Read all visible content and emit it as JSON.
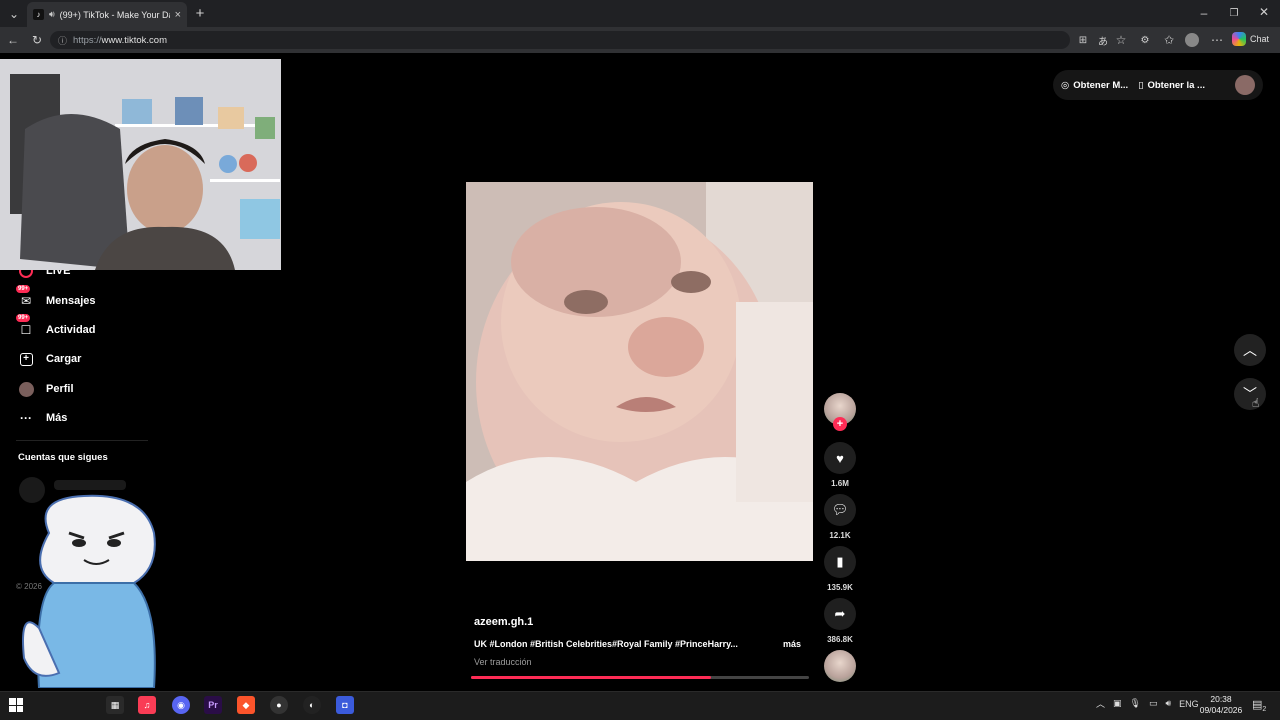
{
  "browser": {
    "tab_title": "(99+) TikTok - Make Your Day",
    "new_tab": "+",
    "url_protocol": "https://",
    "url_host": "www.tiktok.com",
    "chat_label": "Chat",
    "window_controls": [
      "minimize-icon",
      "restore-icon",
      "close-icon"
    ]
  },
  "sidebar": {
    "items": [
      {
        "label": "LIVE",
        "icon": "live-icon"
      },
      {
        "label": "Mensajes",
        "icon": "message-icon",
        "badge": "99+"
      },
      {
        "label": "Actividad",
        "icon": "activity-icon",
        "badge": "99+"
      },
      {
        "label": "Cargar",
        "icon": "upload-icon"
      },
      {
        "label": "Perfil",
        "icon": "profile-icon"
      },
      {
        "label": "Más",
        "icon": "more-icon"
      }
    ],
    "following_heading": "Cuentas que sigues",
    "copyright": "© 2026"
  },
  "top_actions": {
    "get_coins": "Obtener M...",
    "get_app": "Obtener la ..."
  },
  "video": {
    "author": "azeem.gh.1",
    "caption": "UK #London #British Celebrities#Royal Family #PrinceHarry...",
    "more": "más",
    "translate": "Ver traducción",
    "progress": 0.71
  },
  "actions": {
    "likes": "1.6M",
    "comments": "12.1K",
    "saves": "135.9K",
    "shares": "386.8K"
  },
  "taskbar": {
    "language": "ENG",
    "time": "20:38",
    "date": "09/04/2026",
    "notifications": "2"
  },
  "colors": {
    "accent": "#fe2c55",
    "background": "#000000"
  }
}
